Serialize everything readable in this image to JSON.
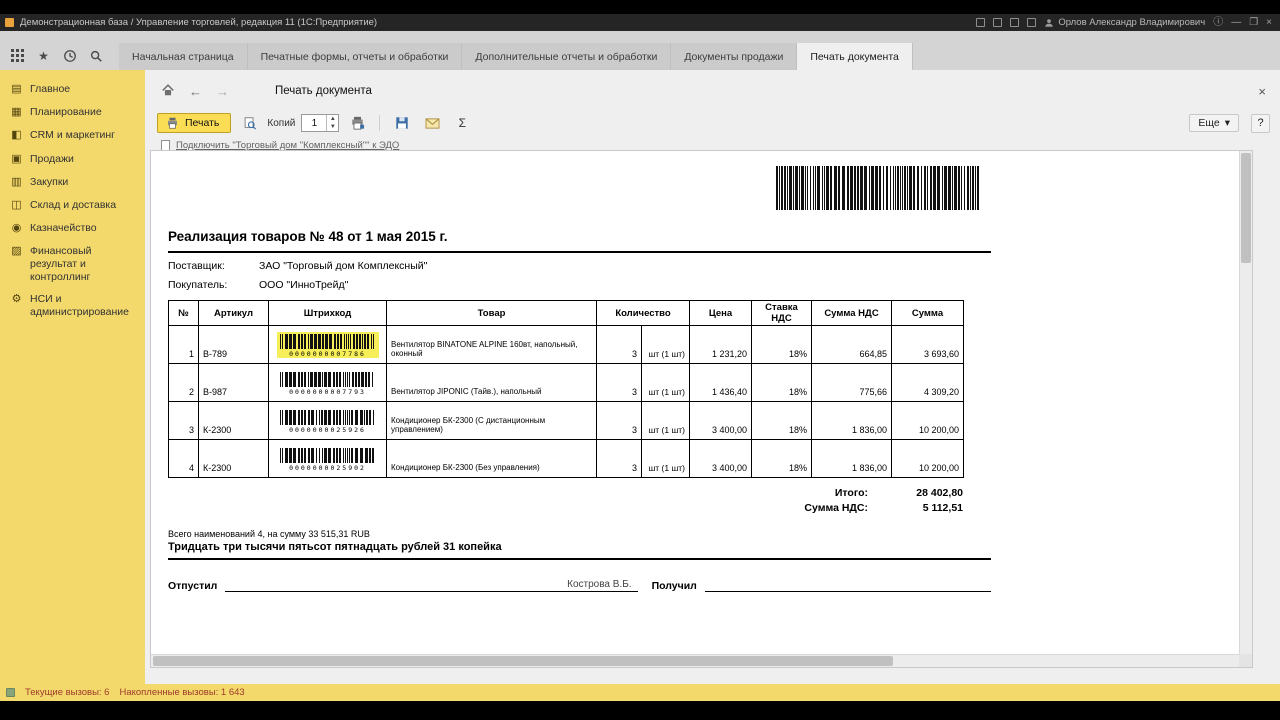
{
  "window": {
    "title": "Демонстрационная база / Управление торговлей, редакция 11  (1С:Предприятие)",
    "user": "Орлов Александр Владимирович"
  },
  "icons": {
    "back": "←",
    "forward": "→",
    "home_hint": "home",
    "close_x": "×",
    "star": "★",
    "sigma": "Σ",
    "more_arrow": "▾",
    "info": "ⓘ",
    "win_min": "—",
    "win_max": "❐",
    "win_close": "×",
    "spin_up": "▲",
    "spin_down": "▼",
    "sidebar": [
      "▤",
      "▦",
      "◧",
      "▣",
      "▥",
      "◫",
      "◉",
      "▨",
      "⚙"
    ]
  },
  "tabs": [
    {
      "label": "Начальная страница"
    },
    {
      "label": "Печатные формы, отчеты и обработки"
    },
    {
      "label": "Дополнительные отчеты и обработки"
    },
    {
      "label": "Документы продажи"
    },
    {
      "label": "Печать документа"
    }
  ],
  "sidebar": {
    "items": [
      "Главное",
      "Планирование",
      "CRM и маркетинг",
      "Продажи",
      "Закупки",
      "Склад и доставка",
      "Казначейство",
      "Финансовый результат и контроллинг",
      "НСИ и администрирование"
    ]
  },
  "page": {
    "title": "Печать документа",
    "print_button": "Печать",
    "copies_label": "Копий",
    "copies_value": "1",
    "more_button": "Еще",
    "help_button": "?",
    "edo_link": "Подключить \"Торговый дом \"Комплексный\"\" к ЭДО"
  },
  "document": {
    "title": "Реализация товаров № 48 от 1 мая 2015 г.",
    "supplier_label": "Поставщик:",
    "supplier": "ЗАО \"Торговый дом Комплексный\"",
    "buyer_label": "Покупатель:",
    "buyer": "ООО \"ИнноТрейд\"",
    "table": {
      "headers": [
        "№",
        "Артикул",
        "Штрихкод",
        "Товар",
        "Количество",
        "Цена",
        "Ставка НДС",
        "Сумма НДС",
        "Сумма"
      ],
      "rows": [
        {
          "num": "1",
          "article": "В-789",
          "barcode": "0000000007786",
          "product": "Вентилятор BINATONE ALPINE 160вт, напольный, оконный",
          "qty": "3",
          "unit": "шт (1 шт)",
          "price": "1 231,20",
          "vat_rate": "18%",
          "vat_sum": "664,85",
          "sum": "3 693,60",
          "highlighted": true
        },
        {
          "num": "2",
          "article": "В-987",
          "barcode": "0000000007793",
          "product": "Вентилятор JIPONIC (Тайв.), напольный",
          "qty": "3",
          "unit": "шт (1 шт)",
          "price": "1 436,40",
          "vat_rate": "18%",
          "vat_sum": "775,66",
          "sum": "4 309,20"
        },
        {
          "num": "3",
          "article": "К-2300",
          "barcode": "0000000025926",
          "product": "Кондиционер БК-2300 (С дистанционным управлением)",
          "qty": "3",
          "unit": "шт (1 шт)",
          "price": "3 400,00",
          "vat_rate": "18%",
          "vat_sum": "1 836,00",
          "sum": "10 200,00"
        },
        {
          "num": "4",
          "article": "К-2300",
          "barcode": "0000000025902",
          "product": "Кондиционер БК-2300 (Без управления)",
          "qty": "3",
          "unit": "шт (1 шт)",
          "price": "3 400,00",
          "vat_rate": "18%",
          "vat_sum": "1 836,00",
          "sum": "10 200,00"
        }
      ],
      "total_label": "Итого:",
      "total": "28 402,80",
      "vat_total_label": "Сумма НДС:",
      "vat_total": "5 112,51"
    },
    "summary_line": "Всего наименований 4, на сумму 33 515,31 RUB",
    "amount_words": "Тридцать три тысячи пятьсот пятнадцать рублей 31 копейка",
    "released_label": "Отпустил",
    "released_by": "Кострова В.Б.",
    "received_label": "Получил"
  },
  "statusbar": {
    "current": "Текущие вызовы: 6",
    "accumulated": "Накопленные вызовы: 1 643"
  }
}
